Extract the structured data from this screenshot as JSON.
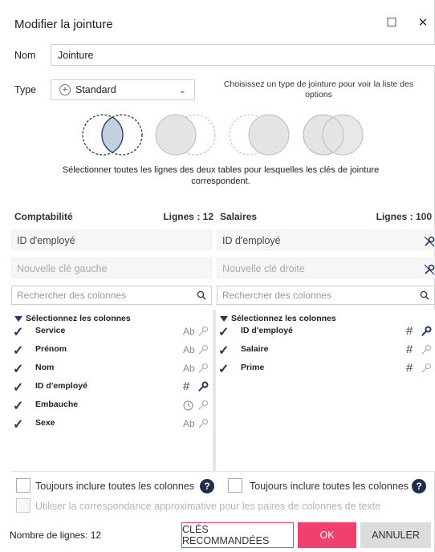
{
  "title": "Modifier la jointure",
  "window": {
    "maximize_glyph": "☐",
    "close_glyph": "✕"
  },
  "nom": {
    "label": "Nom",
    "value": "Jointure"
  },
  "type": {
    "label": "Type",
    "selected": "Standard",
    "hint": "Choisissez un type de jointure pour voir la liste des options",
    "options": [
      {
        "name": "inner-join",
        "selected": true
      },
      {
        "name": "left-join",
        "selected": false
      },
      {
        "name": "right-join",
        "selected": false
      },
      {
        "name": "full-join",
        "selected": false
      }
    ],
    "description": "Sélectionner toutes les lignes des deux tables pour lesquelles les clés de jointure correspondent."
  },
  "left": {
    "table": "Comptabilité",
    "rows_label": "Lignes : 12",
    "key": "ID d'employé",
    "new_key_placeholder": "Nouvelle clé gauche",
    "search_placeholder": "Rechercher des colonnes",
    "columns_header": "Sélectionnez les colonnes",
    "columns": [
      {
        "name": "Service",
        "type": "Ab",
        "is_key": false
      },
      {
        "name": "Prénom",
        "type": "Ab",
        "is_key": false
      },
      {
        "name": "Nom",
        "type": "Ab",
        "is_key": false
      },
      {
        "name": "ID d'employé",
        "type": "#",
        "is_key": true
      },
      {
        "name": "Embauche",
        "type": "clock",
        "is_key": false
      },
      {
        "name": "Sexe",
        "type": "Ab",
        "is_key": false
      }
    ]
  },
  "right": {
    "table": "Salaires",
    "rows_label": "Lignes : 100",
    "key": "ID d'employé",
    "new_key_placeholder": "Nouvelle clé droite",
    "search_placeholder": "Rechercher des colonnes",
    "columns_header": "Sélectionnez les colonnes",
    "columns": [
      {
        "name": "ID d'employé",
        "type": "#",
        "is_key": true
      },
      {
        "name": "Salaire",
        "type": "#",
        "is_key": false
      },
      {
        "name": "Prime",
        "type": "#",
        "is_key": false
      }
    ]
  },
  "options": {
    "include_all_left": "Toujours inclure toutes les colonnes",
    "include_all_right": "Toujours inclure toutes les colonnes",
    "fuzzy_match": "Utiliser la correspondance approximative pour les paires de colonnes de texte"
  },
  "footer": {
    "row_count": "Nombre de lignes: 12",
    "recommended_label": "CLÉS RECOMMANDÉES",
    "ok_label": "OK",
    "cancel_label": "ANNULER"
  },
  "colors": {
    "accent": "#f0416e",
    "navy": "#1f3a5c",
    "venn_fill": "#c4d0de",
    "venn_gray": "#e4e4e4"
  }
}
